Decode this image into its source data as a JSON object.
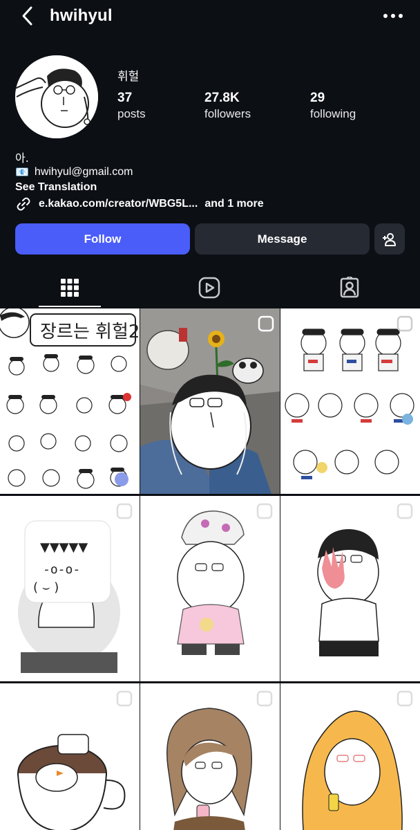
{
  "header": {
    "username": "hwihyul",
    "back_icon": "chevron-left-icon",
    "more_icon": "ellipsis-icon"
  },
  "profile": {
    "display_name": "휘헐",
    "stats": {
      "posts": {
        "value": "37",
        "label": "posts"
      },
      "followers": {
        "value": "27.8K",
        "label": "followers"
      },
      "following": {
        "value": "29",
        "label": "following"
      }
    },
    "bio": {
      "line1": "아.",
      "email_icon": "📧",
      "email": "hwihyul@gmail.com",
      "see_translation": "See Translation",
      "link": "e.kakao.com/creator/WBG5L...",
      "link_more": "and 1 more"
    }
  },
  "actions": {
    "follow_label": "Follow",
    "message_label": "Message",
    "add_person_icon": "add-person-icon"
  },
  "tabs": [
    {
      "name": "grid",
      "icon": "grid-icon",
      "active": true
    },
    {
      "name": "reels",
      "icon": "reels-icon",
      "active": false
    },
    {
      "name": "tagged",
      "icon": "tagged-person-icon",
      "active": false
    }
  ],
  "posts": {
    "first_post_title": "장르는 휘헐2",
    "sticker_caption": "▼▼▼▼▼"
  },
  "colors": {
    "background": "#0c0f14",
    "follow_button": "#4a5df9",
    "secondary_button": "#262a33",
    "text": "#ffffff"
  }
}
